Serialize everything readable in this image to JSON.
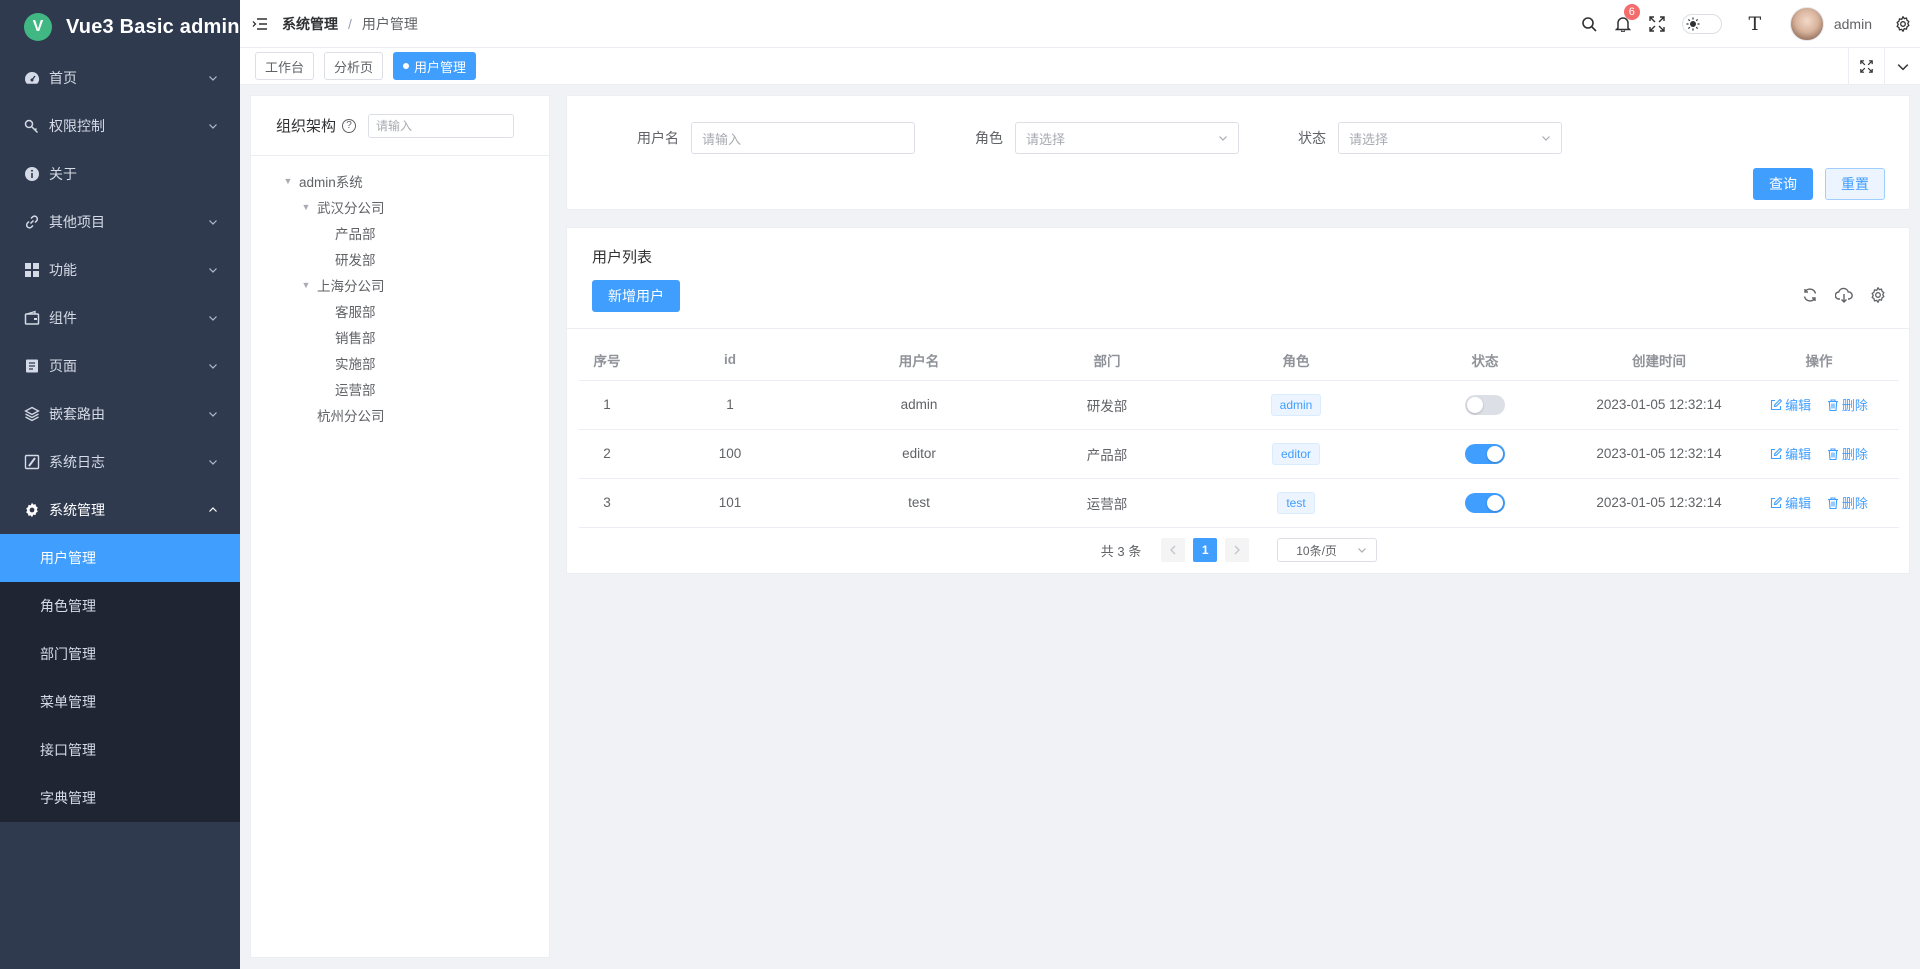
{
  "app": {
    "title": "Vue3 Basic admin",
    "logo_letter": "V"
  },
  "sidebar": {
    "menus": [
      {
        "label": "首页",
        "icon": "dashboard-icon"
      },
      {
        "label": "权限控制",
        "icon": "key-icon"
      },
      {
        "label": "关于",
        "icon": "info-icon"
      },
      {
        "label": "其他项目",
        "icon": "link-icon"
      },
      {
        "label": "功能",
        "icon": "grid-icon"
      },
      {
        "label": "组件",
        "icon": "wallet-icon"
      },
      {
        "label": "页面",
        "icon": "page-icon"
      },
      {
        "label": "嵌套路由",
        "icon": "layers-icon"
      },
      {
        "label": "系统日志",
        "icon": "log-icon"
      },
      {
        "label": "系统管理",
        "icon": "gear-icon"
      }
    ],
    "sub_items": [
      "用户管理",
      "角色管理",
      "部门管理",
      "菜单管理",
      "接口管理",
      "字典管理"
    ],
    "active_sub": "用户管理"
  },
  "header": {
    "breadcrumb": [
      "系统管理",
      "用户管理"
    ],
    "separator": "/",
    "notifications": "6",
    "font_icon_label": "T",
    "username": "admin"
  },
  "tabs": [
    {
      "label": "工作台",
      "active": false
    },
    {
      "label": "分析页",
      "active": false
    },
    {
      "label": "用户管理",
      "active": true
    }
  ],
  "tree_panel": {
    "title": "组织架构",
    "help": "?",
    "search_placeholder": "请输入",
    "nodes": [
      {
        "label": "admin系统",
        "level": 0,
        "expanded": true
      },
      {
        "label": "武汉分公司",
        "level": 1,
        "expanded": true
      },
      {
        "label": "产品部",
        "level": 2
      },
      {
        "label": "研发部",
        "level": 2
      },
      {
        "label": "上海分公司",
        "level": 1,
        "expanded": true
      },
      {
        "label": "客服部",
        "level": 2
      },
      {
        "label": "销售部",
        "level": 2
      },
      {
        "label": "实施部",
        "level": 2
      },
      {
        "label": "运营部",
        "level": 2
      },
      {
        "label": "杭州分公司",
        "level": 1
      }
    ]
  },
  "search_form": {
    "username_label": "用户名",
    "username_placeholder": "请输入",
    "role_label": "角色",
    "role_placeholder": "请选择",
    "status_label": "状态",
    "status_placeholder": "请选择",
    "query_label": "查询",
    "reset_label": "重置"
  },
  "table_card": {
    "title": "用户列表",
    "add_label": "新增用户",
    "columns": [
      "序号",
      "id",
      "用户名",
      "部门",
      "角色",
      "状态",
      "创建时间",
      "操作"
    ],
    "rows": [
      {
        "index": "1",
        "id": "1",
        "username": "admin",
        "dept": "研发部",
        "role": "admin",
        "status": false,
        "created": "2023-01-05 12:32:14"
      },
      {
        "index": "2",
        "id": "100",
        "username": "editor",
        "dept": "产品部",
        "role": "editor",
        "status": true,
        "created": "2023-01-05 12:32:14"
      },
      {
        "index": "3",
        "id": "101",
        "username": "test",
        "dept": "运营部",
        "role": "test",
        "status": true,
        "created": "2023-01-05 12:32:14"
      }
    ],
    "edit_label": "编辑",
    "delete_label": "删除"
  },
  "pagination": {
    "total_text": "共 3 条",
    "current_page": "1",
    "page_size": "10条/页"
  },
  "colors": {
    "primary": "#409eff",
    "sidebar_bg": "#2f3a4f",
    "submenu_bg": "#1f2533",
    "badge": "#f56c6c",
    "logo": "#41b883"
  }
}
